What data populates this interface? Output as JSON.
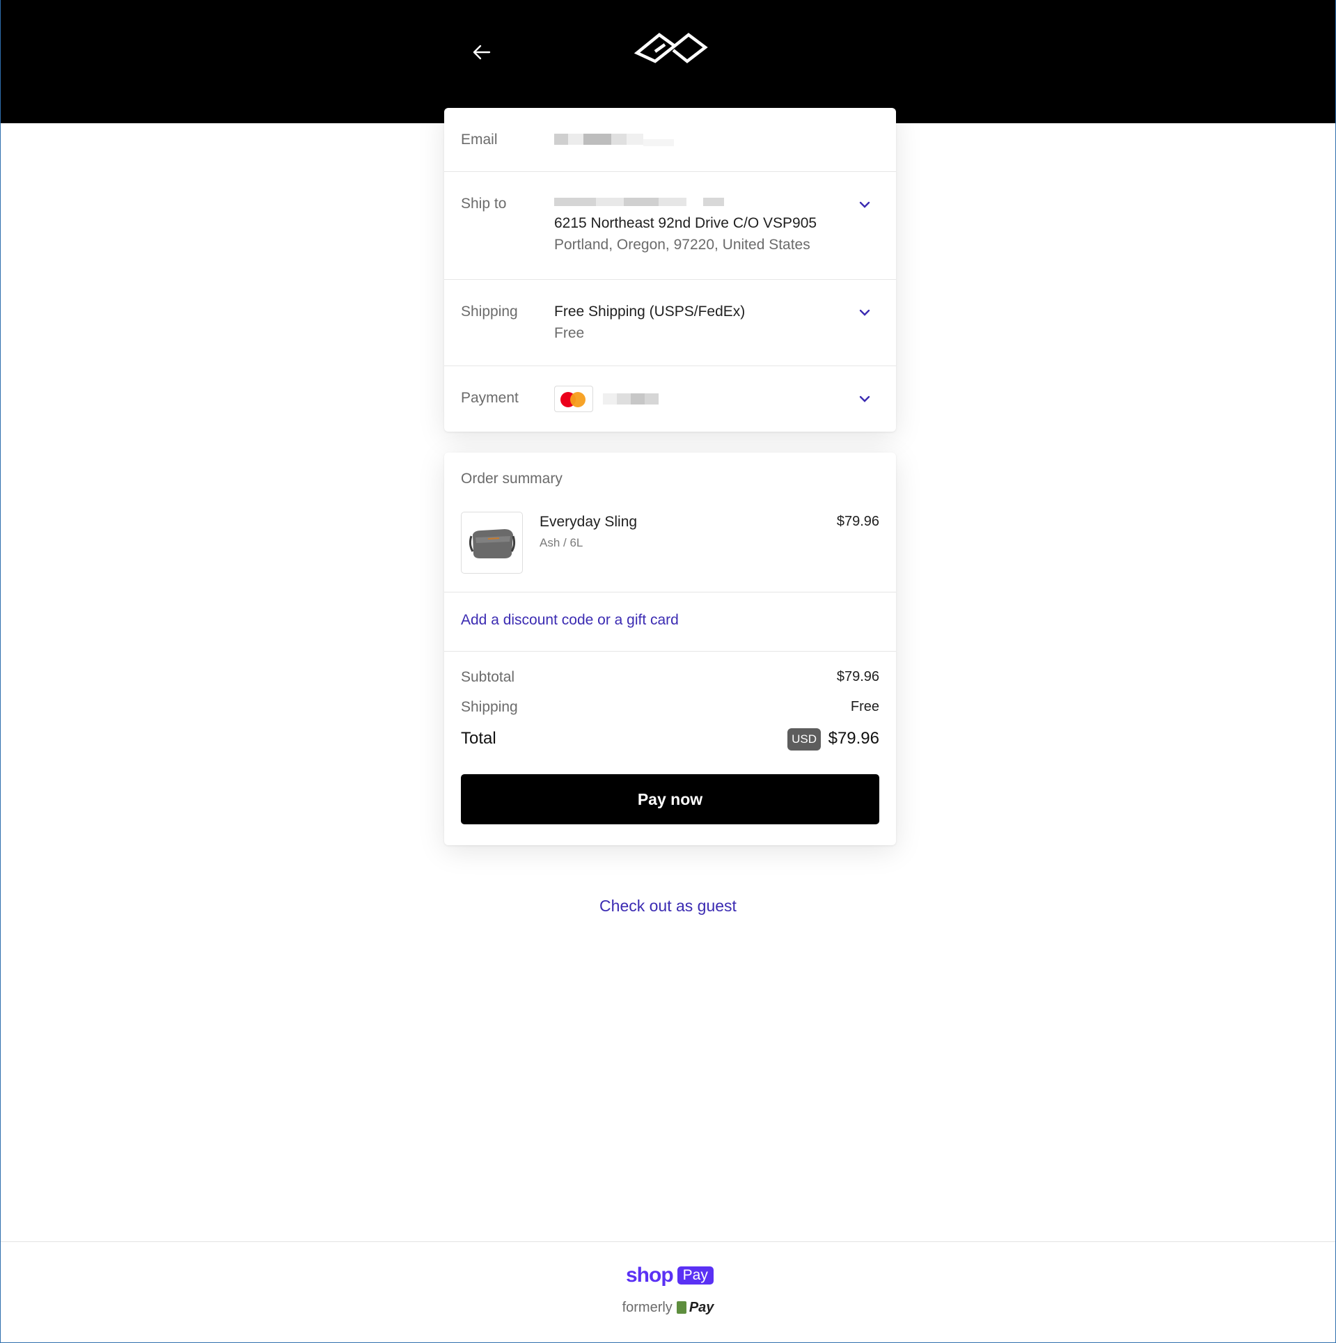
{
  "header": {
    "back_icon": "arrow-left-icon",
    "logo_icon": "peak-design-logo-icon"
  },
  "contact": {
    "email_label": "Email",
    "ship_to_label": "Ship to",
    "address_line2": "6215 Northeast 92nd Drive C/O VSP905",
    "address_line3": "Portland, Oregon, 97220, United States",
    "shipping_label": "Shipping",
    "shipping_method": "Free Shipping (USPS/FedEx)",
    "shipping_cost": "Free",
    "payment_label": "Payment",
    "payment_icon": "mastercard-icon"
  },
  "summary": {
    "title": "Order summary",
    "item_name": "Everyday Sling",
    "item_variant": "Ash / 6L",
    "item_price": "$79.96",
    "discount_link": "Add a discount code or a gift card",
    "subtotal_label": "Subtotal",
    "subtotal_value": "$79.96",
    "shipping_label": "Shipping",
    "shipping_value": "Free",
    "total_label": "Total",
    "currency": "USD",
    "total_value": "$79.96",
    "pay_button": "Pay now"
  },
  "guest_link": "Check out as guest",
  "footer": {
    "shop_text": "shop",
    "pay_badge": "Pay",
    "formerly": "formerly",
    "formerly_pay": "Pay"
  },
  "colors": {
    "accent": "#3b2bb2",
    "shoppay": "#5a31f4"
  }
}
